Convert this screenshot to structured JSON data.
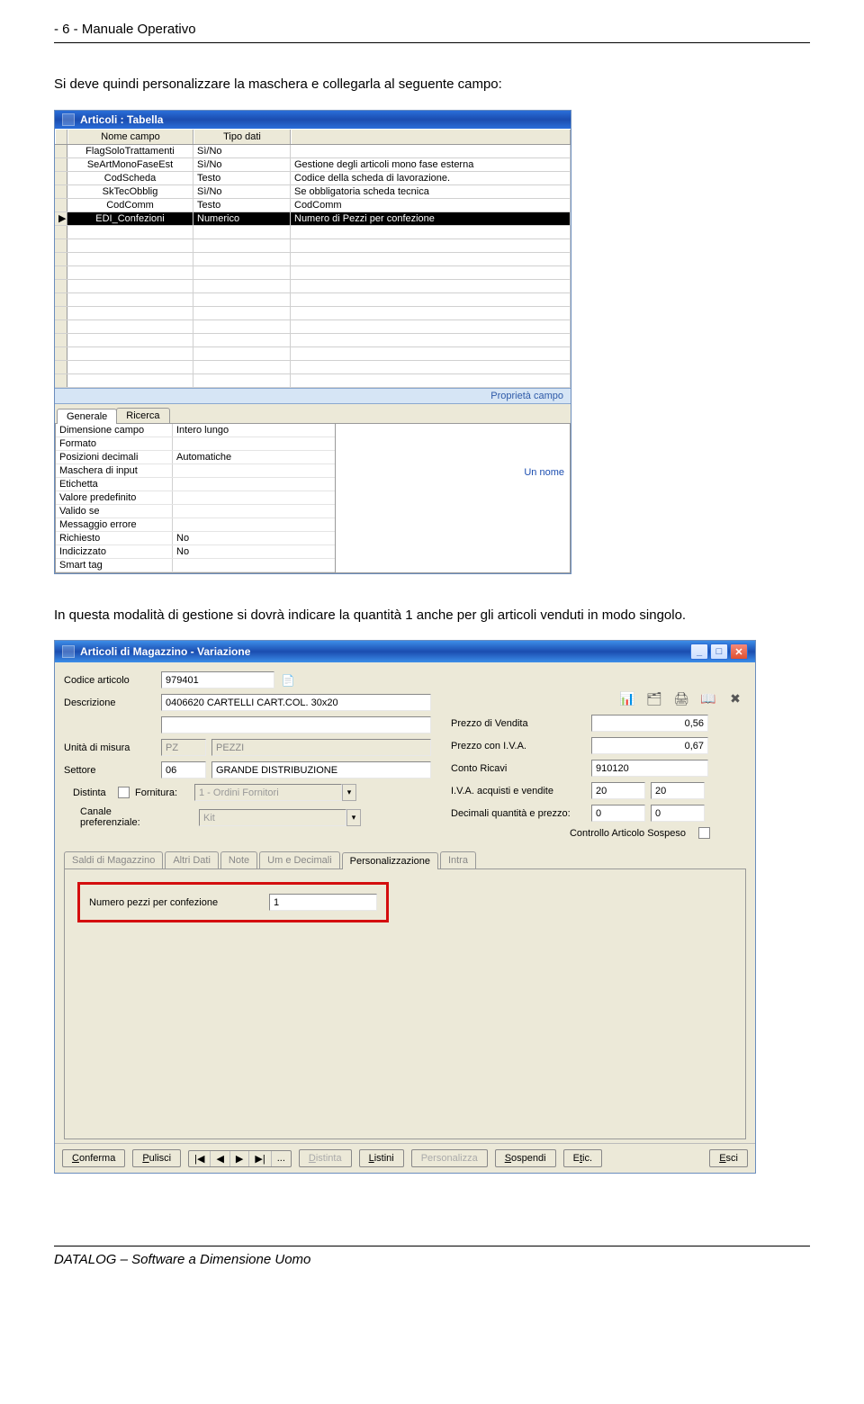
{
  "page": {
    "header": "- 6 -  Manuale Operativo",
    "intro": "Si deve quindi personalizzare la maschera e collegarla al seguente campo:",
    "mid_text": "In questa modalità di gestione si dovrà indicare la quantità 1 anche per gli articoli venduti in modo singolo.",
    "footer": "DATALOG – Software a Dimensione Uomo"
  },
  "win1": {
    "title": "Articoli : Tabella",
    "columns": {
      "c1": "Nome campo",
      "c2": "Tipo dati",
      "c3": ""
    },
    "rows": [
      {
        "c1": "FlagSoloTrattamenti",
        "c2": "Sì/No",
        "c3": ""
      },
      {
        "c1": "SeArtMonoFaseEst",
        "c2": "Sì/No",
        "c3": "Gestione degli articoli mono fase esterna"
      },
      {
        "c1": "CodScheda",
        "c2": "Testo",
        "c3": "Codice della scheda di lavorazione."
      },
      {
        "c1": "SkTecObblig",
        "c2": "Sì/No",
        "c3": "Se obbligatoria scheda tecnica"
      },
      {
        "c1": "CodComm",
        "c2": "Testo",
        "c3": "CodComm"
      },
      {
        "c1": "EDI_Confezioni",
        "c2": "Numerico",
        "c3": "Numero di Pezzi per confezione",
        "selected": true
      }
    ],
    "empty_rows": 12,
    "prop_label": "Proprietà campo",
    "tabs": {
      "generale": "Generale",
      "ricerca": "Ricerca"
    },
    "props": [
      {
        "label": "Dimensione campo",
        "value": "Intero lungo"
      },
      {
        "label": "Formato",
        "value": ""
      },
      {
        "label": "Posizioni decimali",
        "value": "Automatiche"
      },
      {
        "label": "Maschera di input",
        "value": ""
      },
      {
        "label": "Etichetta",
        "value": ""
      },
      {
        "label": "Valore predefinito",
        "value": ""
      },
      {
        "label": "Valido se",
        "value": ""
      },
      {
        "label": "Messaggio errore",
        "value": ""
      },
      {
        "label": "Richiesto",
        "value": "No"
      },
      {
        "label": "Indicizzato",
        "value": "No"
      },
      {
        "label": "Smart tag",
        "value": ""
      }
    ],
    "side_hint": "Un nome"
  },
  "win2": {
    "title": "Articoli di Magazzino - Variazione",
    "toolbar_icons": [
      "chart-icon",
      "card-icon",
      "printer-icon",
      "book-icon",
      "close-x-icon"
    ],
    "fields": {
      "codice_label": "Codice articolo",
      "codice_value": "979401",
      "descr_label": "Descrizione",
      "descr_value": "0406620  CARTELLI CART.COL. 30x20",
      "descr_value2": "",
      "um_label": "Unità di misura",
      "um_code": "PZ",
      "um_desc": "PEZZI",
      "settore_label": "Settore",
      "settore_code": "06",
      "settore_desc": "GRANDE DISTRIBUZIONE",
      "distinta_label": "Distinta",
      "fornitura_label": "Fornitura:",
      "fornitura_value": "1 - Ordini Fornitori",
      "canale_label": "Canale preferenziale:",
      "canale_value": "Kit",
      "prezzo_vend_label": "Prezzo di Vendita",
      "prezzo_vend_value": "0,56",
      "prezzo_iva_label": "Prezzo con I.V.A.",
      "prezzo_iva_value": "0,67",
      "conto_label": "Conto Ricavi",
      "conto_value": "910120",
      "iva_label": "I.V.A. acquisti e vendite",
      "iva_acq": "20",
      "iva_vend": "20",
      "dec_label": "Decimali quantità e prezzo:",
      "dec_q": "0",
      "dec_p": "0",
      "controllo_label": "Controllo Articolo Sospeso"
    },
    "tabs2": [
      {
        "label": "Saldi di Magazzino",
        "u": "M"
      },
      {
        "label": "Altri Dati",
        "u": "A"
      },
      {
        "label": "Note",
        "u": "N"
      },
      {
        "label": "Um e Decimali",
        "u": "U"
      },
      {
        "label": "Personalizzazione",
        "active": true
      },
      {
        "label": "Intra",
        "u": "I"
      }
    ],
    "highlight": {
      "label": "Numero pezzi per confezione",
      "value": "1"
    },
    "bottom": {
      "conferma": "Conferma",
      "pulisci": "Pulisci",
      "distinta": "Distinta",
      "listini": "Listini",
      "personalizza": "Personalizza",
      "sospendi": "Sospendi",
      "etic": "Etic.",
      "esci": "Esci",
      "nav": [
        "|◀",
        "◀",
        "▶",
        "▶|",
        "..."
      ]
    }
  }
}
